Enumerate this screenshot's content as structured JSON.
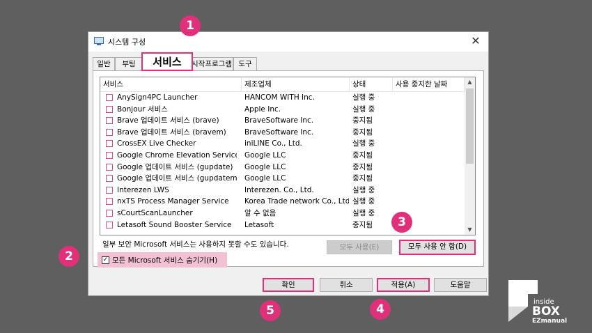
{
  "window": {
    "title": "시스템 구성",
    "close": "✕"
  },
  "tabs": [
    {
      "label": "일반"
    },
    {
      "label": "부팅"
    },
    {
      "label": "서비스"
    },
    {
      "label": "시작프로그램"
    },
    {
      "label": "도구"
    }
  ],
  "table": {
    "headers": [
      "서비스",
      "제조업체",
      "상태",
      "사용 중지한 날짜"
    ],
    "rows": [
      {
        "name": "AnySign4PC Launcher",
        "maker": "HANCOM WITH Inc.",
        "status": "실행 중",
        "date": ""
      },
      {
        "name": "Bonjour 서비스",
        "maker": "Apple Inc.",
        "status": "실행 중",
        "date": ""
      },
      {
        "name": "Brave 업데이트 서비스 (brave)",
        "maker": "BraveSoftware Inc.",
        "status": "중지됨",
        "date": ""
      },
      {
        "name": "Brave 업데이트 서비스 (bravem)",
        "maker": "BraveSoftware Inc.",
        "status": "중지됨",
        "date": ""
      },
      {
        "name": "CrossEX Live Checker",
        "maker": "iniLINE Co., Ltd.",
        "status": "실행 중",
        "date": ""
      },
      {
        "name": "Google Chrome Elevation Service (...",
        "maker": "Google LLC",
        "status": "중지됨",
        "date": ""
      },
      {
        "name": "Google 업데이트 서비스 (gupdate)",
        "maker": "Google LLC",
        "status": "중지됨",
        "date": ""
      },
      {
        "name": "Google 업데이트 서비스 (gupdatem)",
        "maker": "Google LLC",
        "status": "중지됨",
        "date": ""
      },
      {
        "name": "Interezen LWS",
        "maker": "Interezen. Co., Ltd.",
        "status": "실행 중",
        "date": ""
      },
      {
        "name": "nxTS Process Manager Service",
        "maker": "Korea Trade network Co., Ltd.",
        "status": "실행 중",
        "date": ""
      },
      {
        "name": "sCourtScanLauncher",
        "maker": "알 수 없음",
        "status": "실행 중",
        "date": ""
      },
      {
        "name": "Letasoft Sound Booster Service",
        "maker": "Letasoft",
        "status": "중지됨",
        "date": ""
      }
    ]
  },
  "notice": "일부 보안 Microsoft 서비스는 사용하지 못할 수도 있습니다.",
  "buttons": {
    "enable_all": "모두 사용(E)",
    "disable_all": "모두 사용 안 함(D)",
    "ok": "확인",
    "cancel": "취소",
    "apply": "적용(A)",
    "help": "도움말"
  },
  "hide_ms": {
    "label": "모든 Microsoft 서비스 숨기기(H)",
    "checked": true,
    "mark": "✓"
  },
  "badges": [
    "1",
    "2",
    "3",
    "4",
    "5"
  ],
  "logo": {
    "line1": "inside",
    "line2": "BOX",
    "line3": "EZmanual"
  },
  "colors": {
    "accent": "#e0307a",
    "background": "#5f5f5f"
  }
}
